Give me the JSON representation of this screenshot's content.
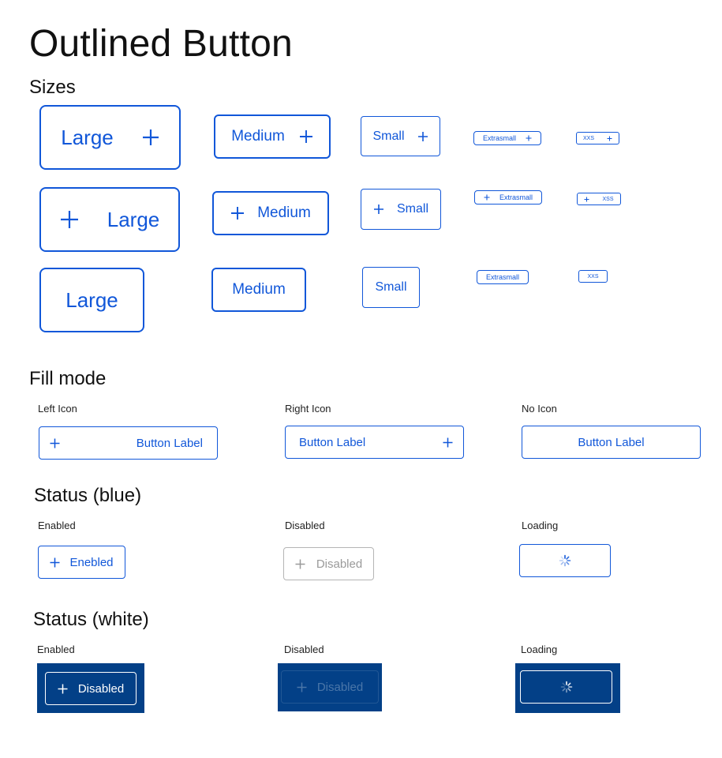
{
  "page": {
    "title": "Outlined Button",
    "sections": {
      "sizes": "Sizes",
      "fill_mode": "Fill mode",
      "status_blue": "Status (blue)",
      "status_white": "Status (white)"
    }
  },
  "sizes": {
    "large": "Large",
    "medium": "Medium",
    "small": "Small",
    "extrasmall": "Extrasmall",
    "xxs": "XXS",
    "xss": "XSS"
  },
  "fill_mode": {
    "left_icon_caption": "Left Icon",
    "right_icon_caption": "Right Icon",
    "no_icon_caption": "No Icon",
    "button_label": "Button Label"
  },
  "status_blue": {
    "enabled_caption": "Enabled",
    "disabled_caption": "Disabled",
    "loading_caption": "Loading",
    "enabled_label": "Enebled",
    "disabled_label": "Disabled"
  },
  "status_white": {
    "enabled_caption": "Enabled",
    "disabled_caption": "Disabled",
    "loading_caption": "Loading",
    "enabled_label": "Disabled",
    "disabled_label": "Disabled"
  },
  "icons": {
    "plus": "plus-icon",
    "spinner": "loading-spinner-icon"
  },
  "colors": {
    "primary": "#1157d9",
    "disabled": "#b5b5b5",
    "dark_panel": "#034087",
    "white": "#ffffff"
  }
}
